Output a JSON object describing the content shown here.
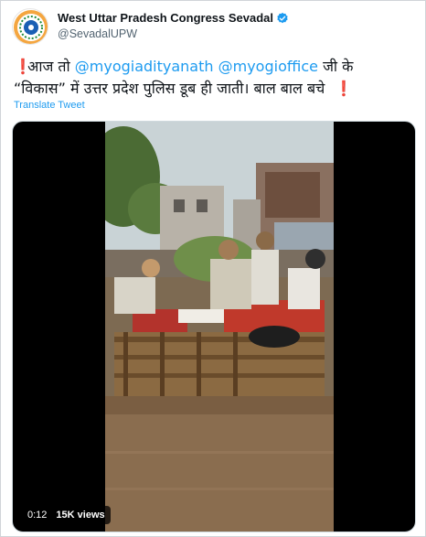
{
  "author": {
    "display_name": "West Uttar Pradesh Congress Sevadal",
    "handle": "@SevadalUPW",
    "verified": true
  },
  "tweet": {
    "text_part1": "आज तो",
    "mention1": "@myogiadityanath",
    "mention2": "@myogioffice",
    "text_part2": "जी के",
    "text_line2": "“विकास” में उत्तर प्रदेश पुलिस डूब ही जाती। बाल बाल बचे",
    "excl_mark": "❗",
    "translate_label": "Translate Tweet"
  },
  "video": {
    "timestamp": "0:12",
    "views": "15K views"
  },
  "colors": {
    "link": "#1d9bf0",
    "exclamation": "#e0245e",
    "secondary_text": "#536471"
  }
}
